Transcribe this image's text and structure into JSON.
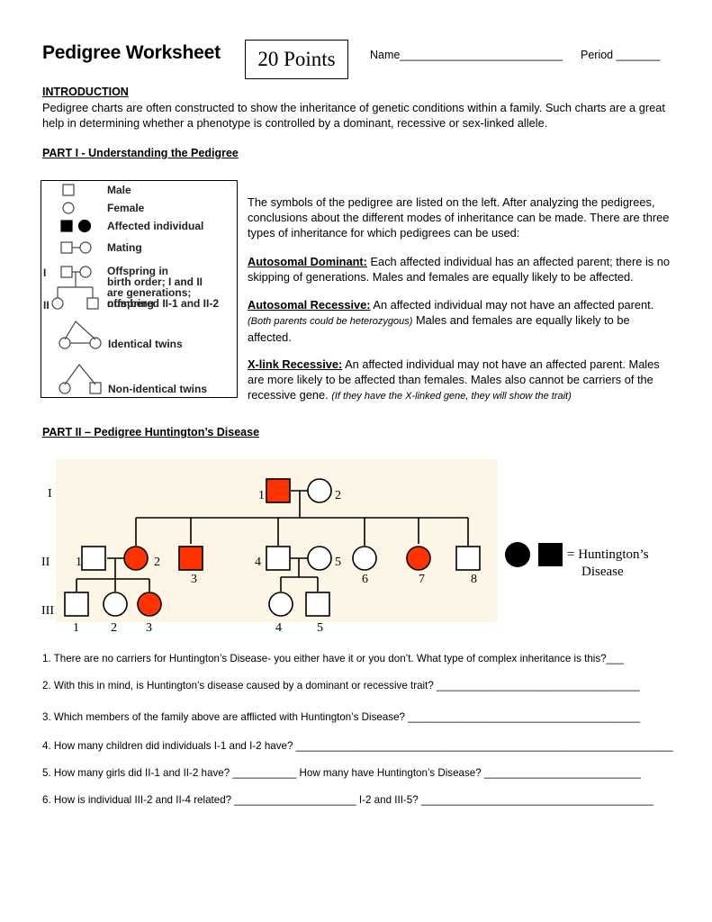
{
  "header": {
    "title": "Pedigree Worksheet",
    "points": "20 Points",
    "name_label": "Name__________________________",
    "period_label": "Period _______"
  },
  "introduction": {
    "heading": "INTRODUCTION",
    "text": "Pedigree charts are often constructed to show the inheritance of genetic conditions within a family. Such charts are a great help in determining whether a phenotype is controlled by a dominant, recessive or sex-linked allele."
  },
  "part1": {
    "heading": "PART I - Understanding the Pedigree",
    "legend": {
      "male": "Male",
      "female": "Female",
      "affected": "Affected individual",
      "mating": "Mating",
      "offspring_1": "Offspring in",
      "offspring_2": "birth order; I and II",
      "offspring_3": "are generations; offspring",
      "offspring_4": "numbered II-1 and II-2",
      "gen_I": "I",
      "gen_II": "II",
      "identical_twins": "Identical twins",
      "nonidentical_twins": "Non-identical twins"
    },
    "intro_text": "The symbols of the pedigree are listed on the left.  After analyzing the pedigrees, conclusions about the different modes of inheritance can be made.  There are three types of inheritance for which pedigrees can be used:",
    "autosomal_dominant": {
      "term": "Autosomal Dominant:",
      "text": " Each affected individual has an affected parent; there is no skipping of generations. Males and females are equally likely to be affected."
    },
    "autosomal_recessive": {
      "term": "Autosomal Recessive:",
      "text": " An affected individual may not have an affected parent.",
      "note": "(Both parents could be heterozygous)",
      "text2": "  Males and females are equally likely to be affected."
    },
    "x_link_recessive": {
      "term": "X-link Recessive:",
      "text": "  An affected individual may not have an affected parent. Males are more likely to be affected than females.  Males also cannot be carriers of the recessive gene.  ",
      "note": "(If they have the X-linked gene, they will show the trait)"
    }
  },
  "part2": {
    "heading": "PART II – Pedigree Huntington’s Disease",
    "generations": [
      "I",
      "II",
      "III"
    ],
    "colors": {
      "affected": "#ff3300",
      "background": "#fdf5e6"
    },
    "individuals": {
      "I": [
        {
          "id": "1",
          "sex": "male",
          "affected": true
        },
        {
          "id": "2",
          "sex": "female",
          "affected": false
        }
      ],
      "II": [
        {
          "id": "1",
          "sex": "male",
          "affected": false
        },
        {
          "id": "2",
          "sex": "female",
          "affected": true
        },
        {
          "id": "3",
          "sex": "male",
          "affected": true
        },
        {
          "id": "4",
          "sex": "male",
          "affected": false
        },
        {
          "id": "5",
          "sex": "female",
          "affected": false
        },
        {
          "id": "6",
          "sex": "female",
          "affected": false
        },
        {
          "id": "7",
          "sex": "female",
          "affected": true
        },
        {
          "id": "8",
          "sex": "male",
          "affected": false
        }
      ],
      "III": [
        {
          "id": "1",
          "sex": "male",
          "affected": false
        },
        {
          "id": "2",
          "sex": "female",
          "affected": false
        },
        {
          "id": "3",
          "sex": "female",
          "affected": true
        },
        {
          "id": "4",
          "sex": "female",
          "affected": false
        },
        {
          "id": "5",
          "sex": "male",
          "affected": false
        }
      ]
    },
    "legend_line1": "= Huntington’s",
    "legend_line2": "Disease"
  },
  "questions": [
    "1. There are no carriers for Huntington’s Disease- you either have it or you don’t.  What type of complex inheritance is this?___",
    "2.  With this in mind, is Huntington’s disease caused by a dominant or recessive trait? ___________________________________",
    "3. Which members of the family above are afflicted with Huntington’s Disease? ________________________________________",
    "4. How many children did individuals I-1 and I-2 have? _________________________________________________________________",
    "5. How many girls did II-1 and II-2 have? ___________ How many have Huntington’s Disease? ___________________________",
    "6. How is individual III-2 and II-4 related? _____________________ I-2 and III-5? ________________________________________"
  ]
}
